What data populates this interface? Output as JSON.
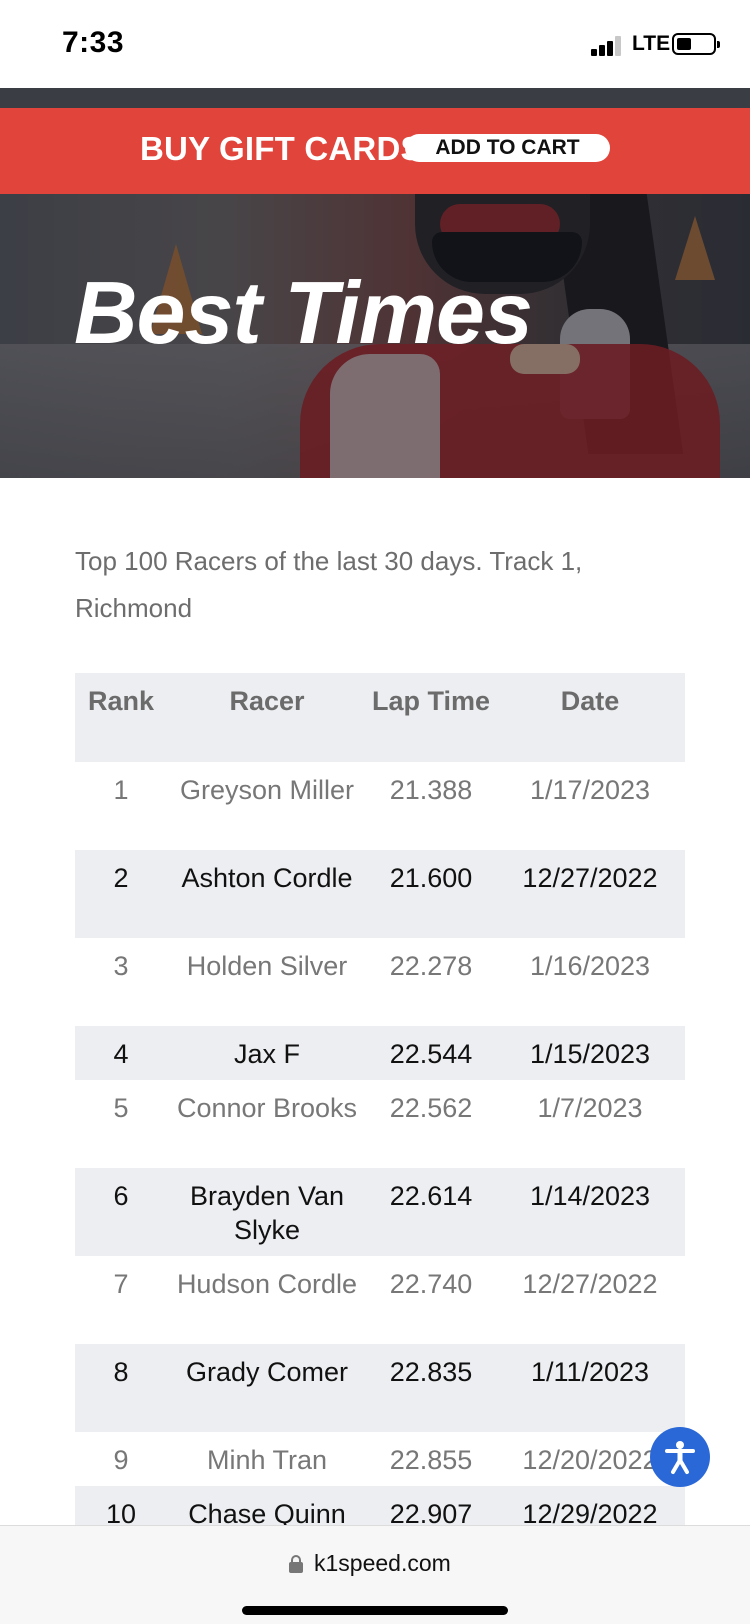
{
  "status_bar": {
    "time": "7:33",
    "network": "LTE",
    "battery_icon": "battery-icon",
    "signal_icon": "signal-icon"
  },
  "promo": {
    "text": "BUY GIFT CARDS",
    "button_label": "ADD TO CART",
    "color": "#e1443a"
  },
  "hero": {
    "title": "Best Times"
  },
  "intro": "Top 100 Racers of the last 30 days. Track 1, Richmond",
  "table": {
    "headers": [
      "Rank",
      "Racer",
      "Lap Time",
      "Date"
    ],
    "rows": [
      {
        "rank": "1",
        "racer": "Greyson Miller",
        "lap": "21.388",
        "date": "1/17/2023"
      },
      {
        "rank": "2",
        "racer": "Ashton Cordle",
        "lap": "21.600",
        "date": "12/27/2022"
      },
      {
        "rank": "3",
        "racer": "Holden Silver",
        "lap": "22.278",
        "date": "1/16/2023"
      },
      {
        "rank": "4",
        "racer": "Jax F",
        "lap": "22.544",
        "date": "1/15/2023"
      },
      {
        "rank": "5",
        "racer": "Connor Brooks",
        "lap": "22.562",
        "date": "1/7/2023"
      },
      {
        "rank": "6",
        "racer": "Brayden Van Slyke",
        "lap": "22.614",
        "date": "1/14/2023"
      },
      {
        "rank": "7",
        "racer": "Hudson Cordle",
        "lap": "22.740",
        "date": "12/27/2022"
      },
      {
        "rank": "8",
        "racer": "Grady Comer",
        "lap": "22.835",
        "date": "1/11/2023"
      },
      {
        "rank": "9",
        "racer": "Minh Tran",
        "lap": "22.855",
        "date": "12/20/2022"
      },
      {
        "rank": "10",
        "racer": "Chase Quinn",
        "lap": "22.907",
        "date": "12/29/2022"
      }
    ]
  },
  "browser": {
    "url": "k1speed.com",
    "lock_icon": "lock-icon"
  },
  "accessibility": {
    "icon": "accessibility-icon",
    "color": "#2a68d8"
  }
}
